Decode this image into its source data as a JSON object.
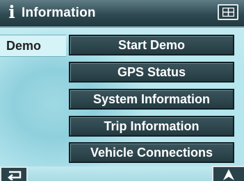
{
  "header": {
    "title": "Information",
    "title_icon": "info-i-icon",
    "menu_icon": "menu-grid-icon"
  },
  "category": {
    "label": "Demo"
  },
  "menu": {
    "items": [
      {
        "label": "Start Demo"
      },
      {
        "label": "GPS Status"
      },
      {
        "label": "System Information"
      },
      {
        "label": "Trip Information"
      },
      {
        "label": "Vehicle Connections"
      }
    ]
  },
  "footer": {
    "back_icon": "return-arrow-icon",
    "nav_icon": "navigation-arrow-icon"
  },
  "colors": {
    "title_bar": "#2f4a53",
    "button": "#2f4a51",
    "background": "#b7e6ee",
    "category_bg": "#d6f3f7"
  }
}
